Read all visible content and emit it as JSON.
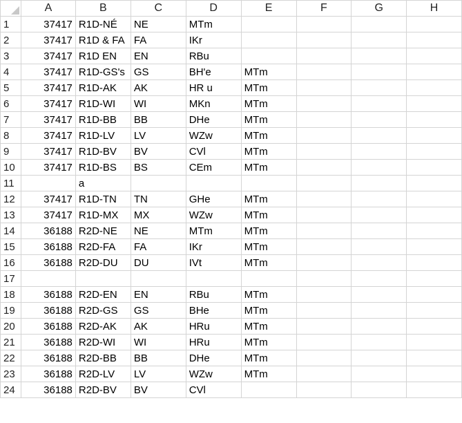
{
  "columns": [
    "A",
    "B",
    "C",
    "D",
    "E",
    "F",
    "G",
    "H"
  ],
  "rows": [
    {
      "n": "1",
      "A": "37417",
      "B": "R1D-NÉ",
      "C": "NE",
      "D": "MTm",
      "E": ""
    },
    {
      "n": "2",
      "A": "37417",
      "B": "R1D & FA",
      "C": "FA",
      "D": "IKr",
      "E": ""
    },
    {
      "n": "3",
      "A": "37417",
      "B": "R1D EN",
      "C": "EN",
      "D": "RBu",
      "E": ""
    },
    {
      "n": "4",
      "A": "37417",
      "B": "R1D-GS's",
      "C": "GS",
      "D": "BH'e",
      "E": "MTm"
    },
    {
      "n": "5",
      "A": "37417",
      "B": "R1D-AK",
      "C": "AK",
      "D": "HR u",
      "E": "MTm"
    },
    {
      "n": "6",
      "A": "37417",
      "B": "R1D-WI",
      "C": "WI",
      "D": "MKn",
      "E": "MTm"
    },
    {
      "n": "7",
      "A": "37417",
      "B": "R1D-BB",
      "C": "BB",
      "D": "DHe",
      "E": "MTm"
    },
    {
      "n": "8",
      "A": "37417",
      "B": "R1D-LV",
      "C": "LV",
      "D": "WZw",
      "E": "MTm"
    },
    {
      "n": "9",
      "A": "37417",
      "B": "R1D-BV",
      "C": "BV",
      "D": "CVl",
      "E": "MTm"
    },
    {
      "n": "10",
      "A": "37417",
      "B": "R1D-BS",
      "C": "BS",
      "D": "CEm",
      "E": "MTm"
    },
    {
      "n": "11",
      "A": "",
      "B": "a",
      "C": "",
      "D": "",
      "E": ""
    },
    {
      "n": "12",
      "A": "37417",
      "B": "R1D-TN",
      "C": "TN",
      "D": "GHe",
      "E": "MTm"
    },
    {
      "n": "13",
      "A": "37417",
      "B": "R1D-MX",
      "C": "MX",
      "D": "WZw",
      "E": "MTm"
    },
    {
      "n": "14",
      "A": "36188",
      "B": "R2D-NE",
      "C": "NE",
      "D": "MTm",
      "E": "MTm"
    },
    {
      "n": "15",
      "A": "36188",
      "B": "R2D-FA",
      "C": "FA",
      "D": "IKr",
      "E": "MTm"
    },
    {
      "n": "16",
      "A": "36188",
      "B": "R2D-DU",
      "C": "DU",
      "D": "IVt",
      "E": "MTm"
    },
    {
      "n": "17",
      "A": "",
      "B": "",
      "C": "",
      "D": "",
      "E": ""
    },
    {
      "n": "18",
      "A": "36188",
      "B": "R2D-EN",
      "C": "EN",
      "D": "RBu",
      "E": "MTm"
    },
    {
      "n": "19",
      "A": "36188",
      "B": "R2D-GS",
      "C": "GS",
      "D": "BHe",
      "E": "MTm"
    },
    {
      "n": "20",
      "A": "36188",
      "B": "R2D-AK",
      "C": "AK",
      "D": "HRu",
      "E": "MTm"
    },
    {
      "n": "21",
      "A": "36188",
      "B": "R2D-WI",
      "C": "WI",
      "D": "HRu",
      "E": "MTm"
    },
    {
      "n": "22",
      "A": "36188",
      "B": "R2D-BB",
      "C": "BB",
      "D": "DHe",
      "E": "MTm"
    },
    {
      "n": "23",
      "A": "36188",
      "B": "R2D-LV",
      "C": "LV",
      "D": "WZw",
      "E": "MTm"
    },
    {
      "n": "24",
      "A": "36188",
      "B": "R2D-BV",
      "C": "BV",
      "D": "CVl",
      "E": ""
    }
  ]
}
